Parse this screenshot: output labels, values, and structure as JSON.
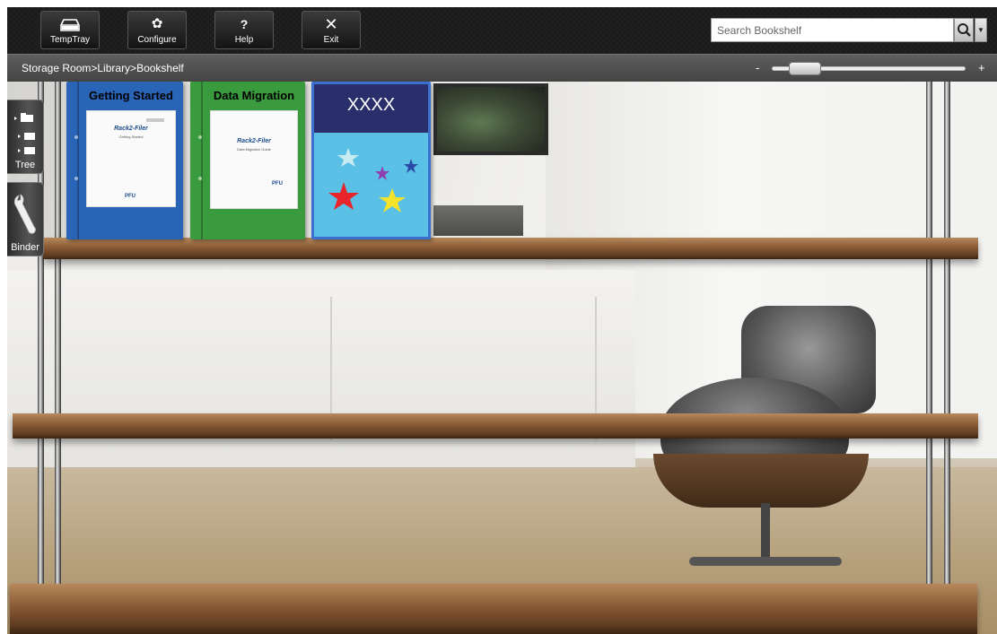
{
  "toolbar": {
    "temptray_label": "TempTray",
    "configure_label": "Configure",
    "help_label": "Help",
    "help_icon_glyph": "?",
    "exit_label": "Exit",
    "exit_icon_glyph": "✕",
    "configure_icon_glyph": "✿"
  },
  "search": {
    "placeholder": "Search Bookshelf",
    "value": ""
  },
  "breadcrumb": {
    "path": "Storage Room>Library>Bookshelf"
  },
  "zoom": {
    "minus_label": "-",
    "plus_label": "+",
    "level": 0.1
  },
  "side_tabs": {
    "tree_label": "Tree",
    "binder_label": "Binder"
  },
  "binders": [
    {
      "title": "Getting Started",
      "brand": "Rack2-Filer",
      "subtitle": "Getting Started",
      "publisher": "PFU",
      "color": "#2a64b6",
      "icon": "binder-cover"
    },
    {
      "title": "Data Migration",
      "brand": "Rack2-Filer",
      "subtitle": "Data Migration Guide",
      "publisher": "PFU",
      "color": "#3a9a3e",
      "icon": "binder-cover"
    },
    {
      "title": "XXXX",
      "color": "#5bc0e6",
      "header_color": "#2a2f6b",
      "icon": "stars-cover"
    }
  ],
  "colors": {
    "toolbar_bg": "#1b1b1b",
    "crumb_bg": "#505050",
    "binder_selected_border": "#3b6fd0"
  }
}
